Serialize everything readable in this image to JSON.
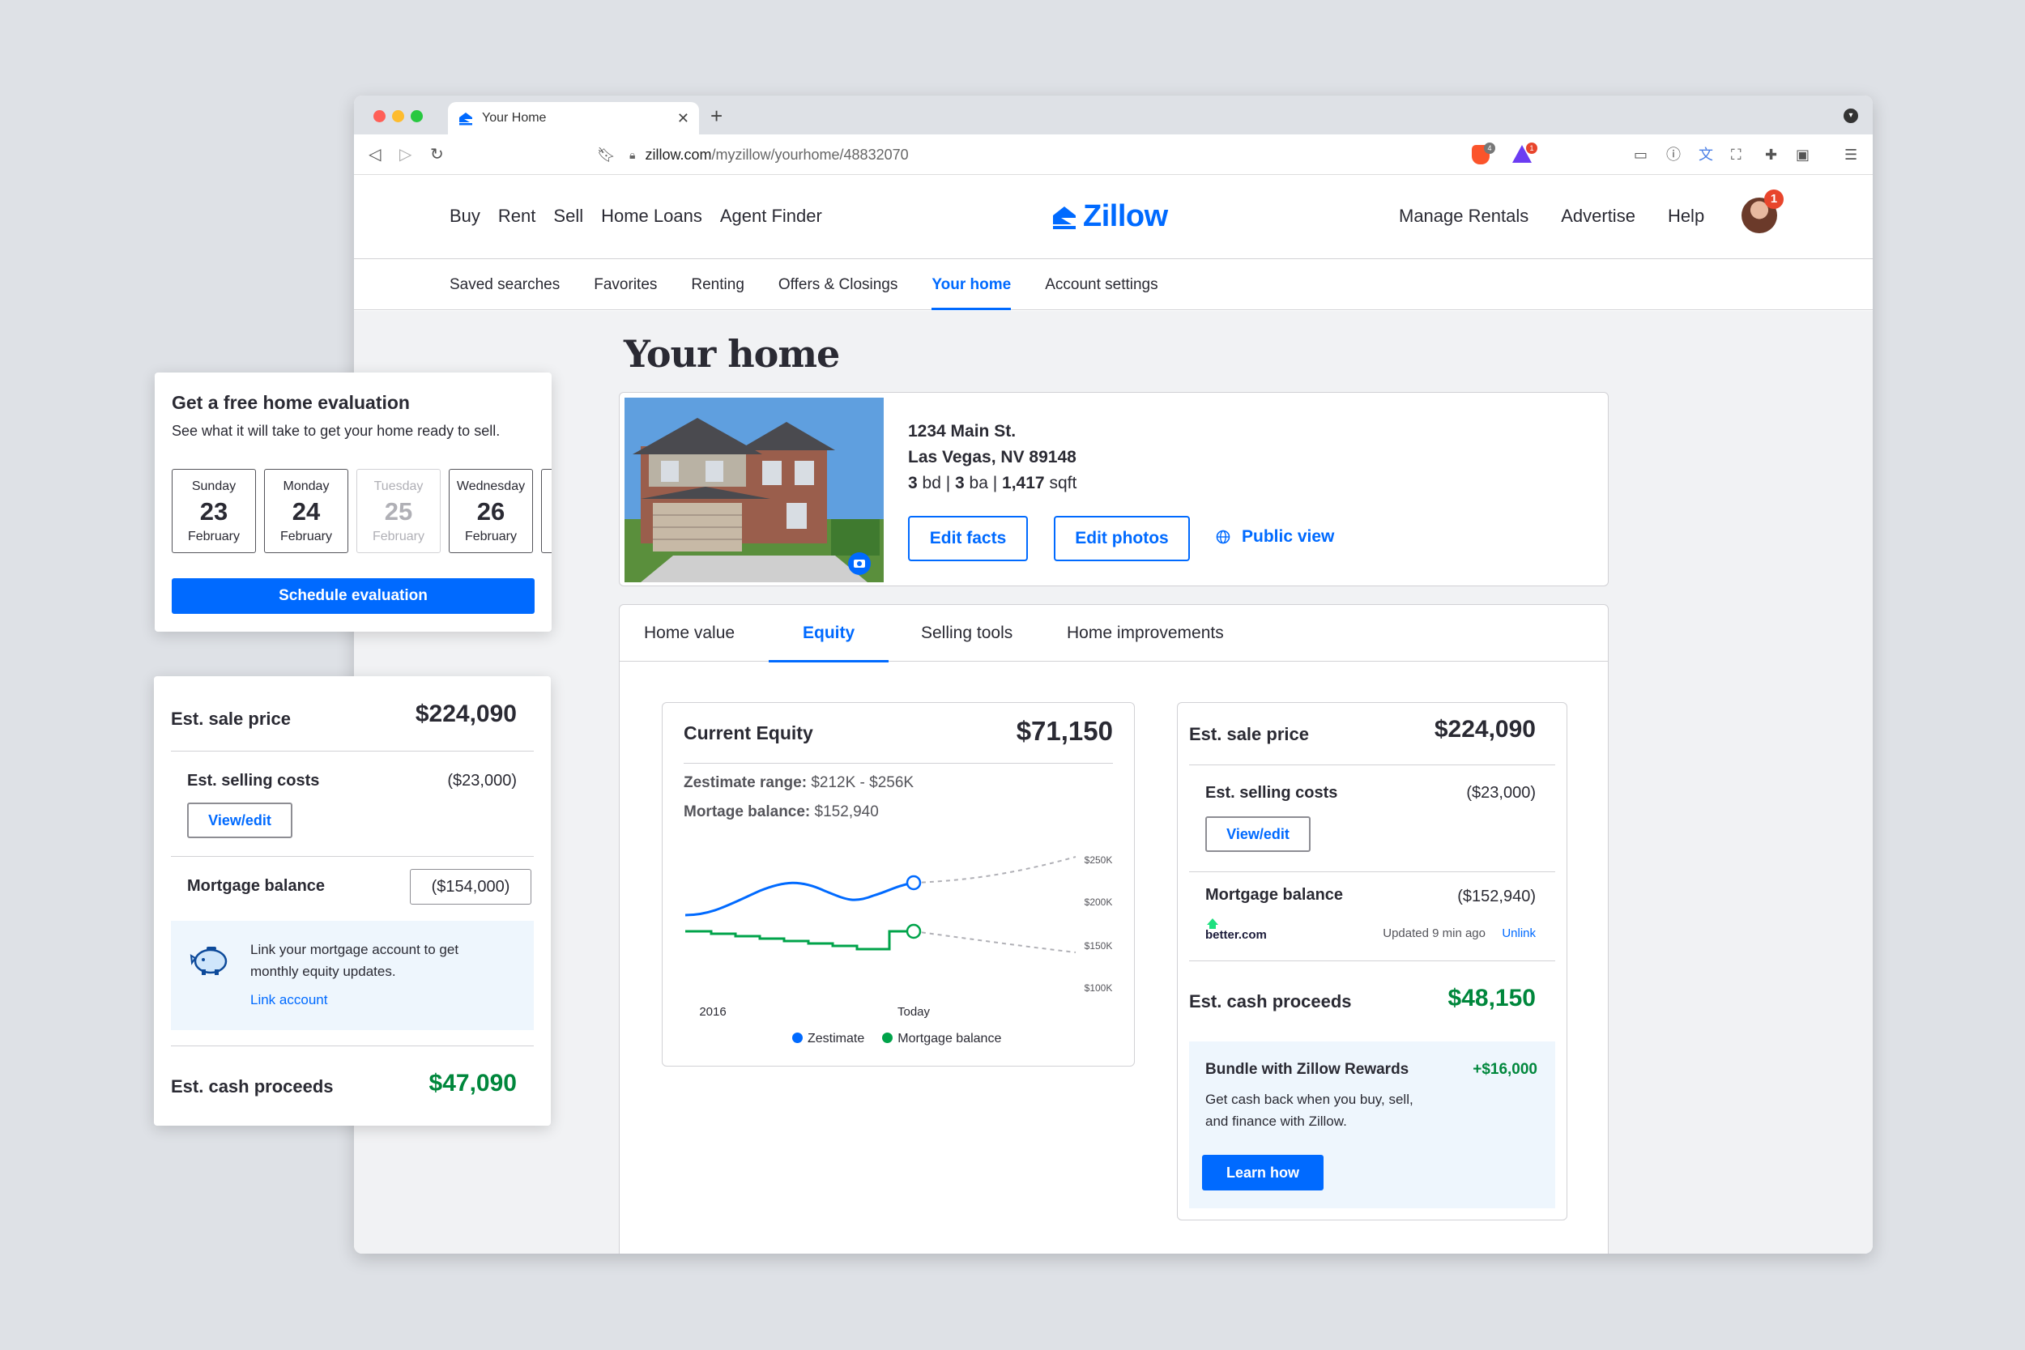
{
  "browser": {
    "tab_title": "Your Home",
    "url_host": "zillow.com",
    "url_path": "/myzillow/yourhome/48832070",
    "brave_count": "4",
    "rewards_count": "1"
  },
  "header": {
    "nav_left": [
      "Buy",
      "Rent",
      "Sell",
      "Home Loans",
      "Agent Finder"
    ],
    "logo_text": "Zillow",
    "nav_right": [
      "Manage Rentals",
      "Advertise",
      "Help"
    ],
    "notification_count": "1"
  },
  "subnav": {
    "items": [
      "Saved searches",
      "Favorites",
      "Renting",
      "Offers & Closings",
      "Your home",
      "Account settings"
    ],
    "active": "Your home"
  },
  "page_title": "Your home",
  "property": {
    "address_line1": "1234 Main St.",
    "address_line2": "Las Vegas, NV 89148",
    "beds": "3",
    "beds_unit": "bd",
    "baths": "3",
    "baths_unit": "ba",
    "sqft": "1,417",
    "sqft_unit": "sqft",
    "edit_facts": "Edit facts",
    "edit_photos": "Edit photos",
    "public_view": "Public view"
  },
  "tabs": {
    "items": [
      "Home value",
      "Equity",
      "Selling tools",
      "Home improvements"
    ],
    "active": "Equity"
  },
  "equity": {
    "title": "Current Equity",
    "value": "$71,150",
    "range_label": "Zestimate range:",
    "range_value": "$212K - $256K",
    "mortgage_label": "Mortage balance:",
    "mortgage_value": "$152,940",
    "legend_zestimate": "Zestimate",
    "legend_mortgage": "Mortgage balance"
  },
  "chart_data": {
    "type": "line",
    "x_labels": [
      "2016",
      "Today"
    ],
    "y_ticks": [
      "$250K",
      "$200K",
      "$150K",
      "$100K"
    ],
    "ylim": [
      100000,
      250000
    ],
    "series": [
      {
        "name": "Zestimate",
        "color": "#006aff"
      },
      {
        "name": "Mortgage balance",
        "color": "#00a34a"
      }
    ]
  },
  "sale_card": {
    "sale_label": "Est. sale price",
    "sale_value": "$224,090",
    "costs_label": "Est. selling costs",
    "costs_value": "($23,000)",
    "view_edit": "View/edit",
    "mortgage_label": "Mortgage balance",
    "mortgage_value": "($152,940)",
    "lender": "better.com",
    "updated": "Updated 9 min ago",
    "unlink": "Unlink",
    "proceeds_label": "Est. cash proceeds",
    "proceeds_value": "$48,150",
    "promo_title": "Bundle with Zillow Rewards",
    "promo_amount": "+$16,000",
    "promo_line1": "Get cash back when you buy, sell,",
    "promo_line2": "and finance with Zillow.",
    "promo_button": "Learn how"
  },
  "eval_card": {
    "title": "Get a free home evaluation",
    "subtitle": "See what it will take to get your home ready to sell.",
    "days": [
      {
        "weekday": "Sunday",
        "day": "23",
        "month": "February"
      },
      {
        "weekday": "Monday",
        "day": "24",
        "month": "February"
      },
      {
        "weekday": "Tuesday",
        "day": "25",
        "month": "February"
      },
      {
        "weekday": "Wednesday",
        "day": "26",
        "month": "February"
      }
    ],
    "button": "Schedule evaluation"
  },
  "sell_card": {
    "sale_label": "Est. sale price",
    "sale_value": "$224,090",
    "costs_label": "Est. selling costs",
    "costs_value": "($23,000)",
    "view_edit": "View/edit",
    "mortgage_label": "Mortgage balance",
    "mortgage_value": "($154,000)",
    "link_text_1": "Link your mortgage account to get",
    "link_text_2": "monthly equity updates.",
    "link_action": "Link account",
    "proceeds_label": "Est. cash proceeds",
    "proceeds_value": "$47,090"
  }
}
